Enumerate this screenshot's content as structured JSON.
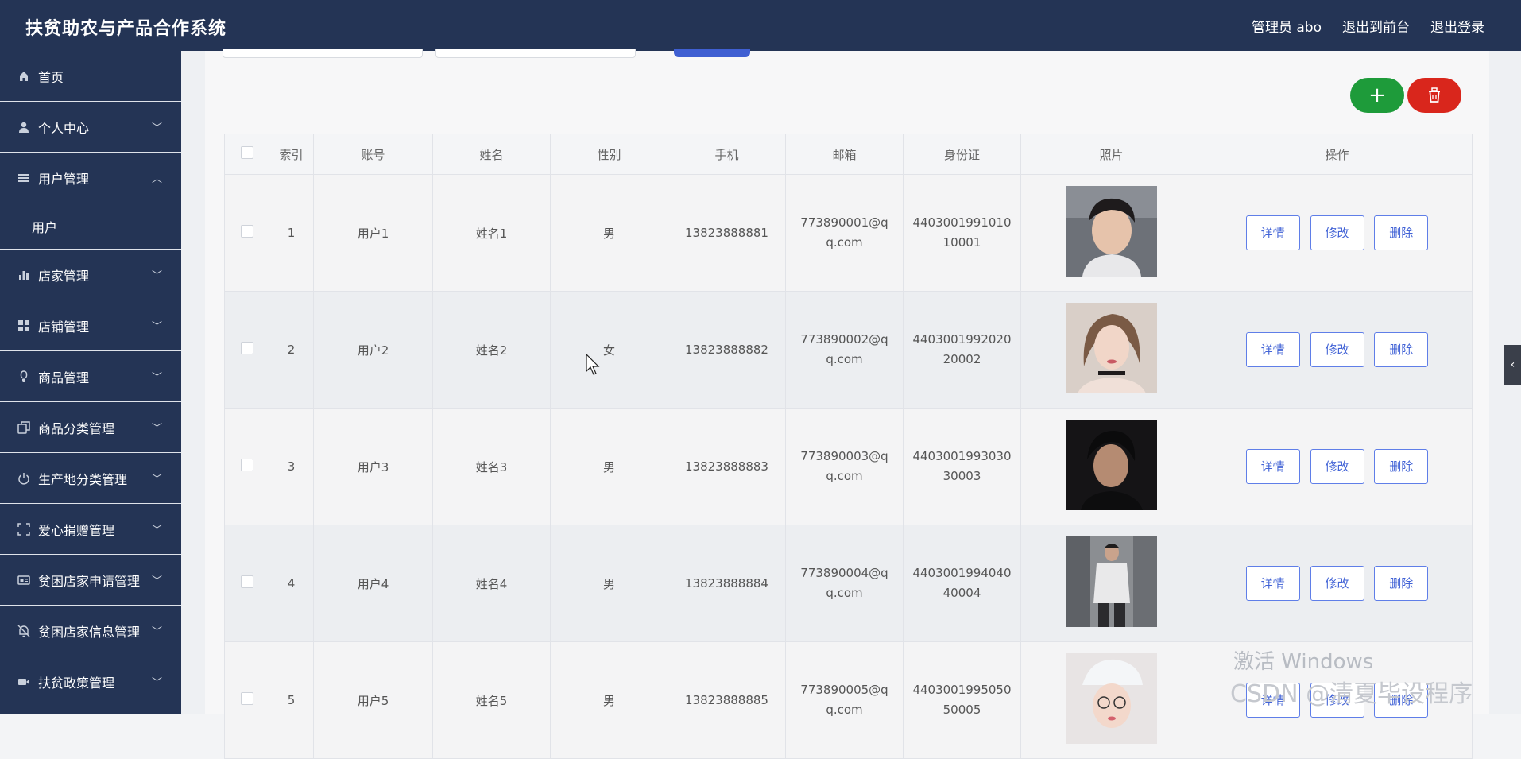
{
  "header": {
    "app_title": "扶贫助农与产品合作系统",
    "links": [
      "管理员 abo",
      "退出到前台",
      "退出登录"
    ]
  },
  "sidebar": {
    "items": [
      {
        "label": "首页",
        "icon": "home-icon",
        "chevron": ""
      },
      {
        "label": "个人中心",
        "icon": "user-icon",
        "chevron": "﹀"
      },
      {
        "label": "用户管理",
        "icon": "list-icon",
        "chevron": "︿"
      },
      {
        "label": "店家管理",
        "icon": "bar-chart-icon",
        "chevron": "﹀"
      },
      {
        "label": "店铺管理",
        "icon": "grid-icon",
        "chevron": "﹀"
      },
      {
        "label": "商品管理",
        "icon": "bulb-icon",
        "chevron": "﹀"
      },
      {
        "label": "商品分类管理",
        "icon": "copy-icon",
        "chevron": "﹀"
      },
      {
        "label": "生产地分类管理",
        "icon": "power-icon",
        "chevron": "﹀"
      },
      {
        "label": "爱心捐赠管理",
        "icon": "fullscreen-icon",
        "chevron": "﹀"
      },
      {
        "label": "贫困店家申请管理",
        "icon": "id-card-icon",
        "chevron": "﹀"
      },
      {
        "label": "贫困店家信息管理",
        "icon": "bell-off-icon",
        "chevron": "﹀"
      },
      {
        "label": "扶贫政策管理",
        "icon": "video-icon",
        "chevron": "﹀"
      }
    ],
    "sub_item": "用户"
  },
  "toolbar": {
    "add_label": "+"
  },
  "table": {
    "columns": [
      "",
      "索引",
      "账号",
      "姓名",
      "性别",
      "手机",
      "邮箱",
      "身份证",
      "照片",
      "操作"
    ],
    "rows": [
      {
        "index": "1",
        "account": "用户1",
        "name": "姓名1",
        "gender": "男",
        "phone": "13823888881",
        "email_1": "773890001@q",
        "email_2": "q.com",
        "id_1": "4403001991010",
        "id_2": "10001"
      },
      {
        "index": "2",
        "account": "用户2",
        "name": "姓名2",
        "gender": "女",
        "phone": "13823888882",
        "email_1": "773890002@q",
        "email_2": "q.com",
        "id_1": "4403001992020",
        "id_2": "20002"
      },
      {
        "index": "3",
        "account": "用户3",
        "name": "姓名3",
        "gender": "男",
        "phone": "13823888883",
        "email_1": "773890003@q",
        "email_2": "q.com",
        "id_1": "4403001993030",
        "id_2": "30003"
      },
      {
        "index": "4",
        "account": "用户4",
        "name": "姓名4",
        "gender": "男",
        "phone": "13823888884",
        "email_1": "773890004@q",
        "email_2": "q.com",
        "id_1": "4403001994040",
        "id_2": "40004"
      },
      {
        "index": "5",
        "account": "用户5",
        "name": "姓名5",
        "gender": "男",
        "phone": "13823888885",
        "email_1": "773890005@q",
        "email_2": "q.com",
        "id_1": "4403001995050",
        "id_2": "50005"
      }
    ],
    "actions": [
      "详情",
      "修改",
      "删除"
    ]
  },
  "overlay": {
    "activate_windows": "激活 Windows",
    "csdn": "CSDN @清夏毕设程序"
  },
  "colors": {
    "topbar": "#243455",
    "add": "#1e9b3a",
    "delete": "#d9261c",
    "action_border": "#5f7ee8"
  }
}
